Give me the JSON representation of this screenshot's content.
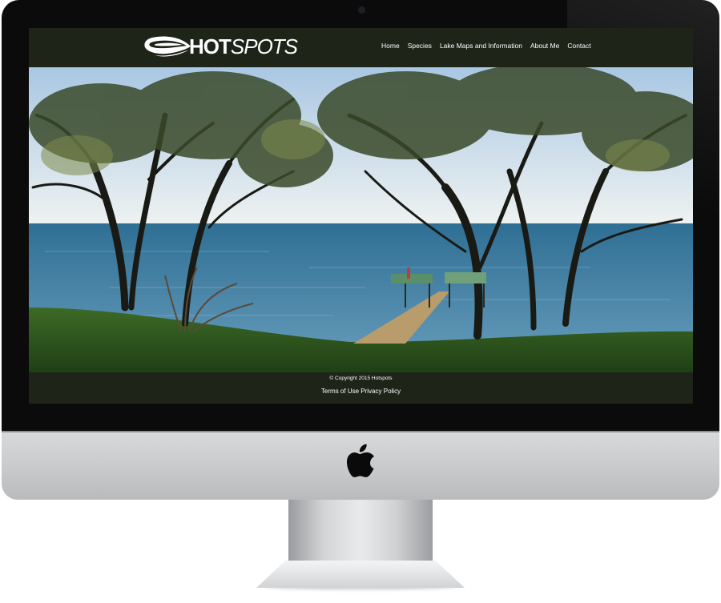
{
  "site": {
    "brand": {
      "bold": "HOT",
      "light": "SPOTS"
    },
    "nav": [
      "Home",
      "Species",
      "Lake Maps and Information",
      "About Me",
      "Contact"
    ],
    "footer": {
      "copyright": "© Copyright 2015 Hotspots",
      "links": [
        "Terms of Use",
        "Privacy Policy"
      ]
    }
  },
  "icons": [
    "apple-logo-icon",
    "flame-logo-icon",
    "camera-icon"
  ],
  "colors": {
    "header_bg": "#1e2418",
    "bezel": "#0b0b0b",
    "sky": "#c9dcef",
    "lake": "#3c7fa3",
    "grass": "#2f5a1f"
  }
}
